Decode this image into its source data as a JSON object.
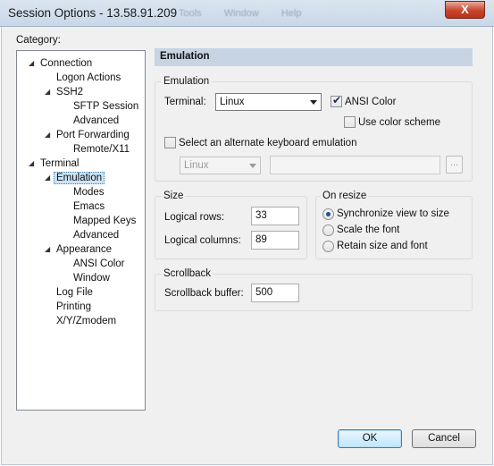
{
  "window": {
    "title": "Session Options - 13.58.91.209",
    "behind_menu": "Tools Window Help",
    "close_glyph": "X"
  },
  "category": {
    "label": "Category:",
    "tree": [
      {
        "label": "Connection",
        "expanded": true
      },
      {
        "label": "Logon Actions"
      },
      {
        "label": "SSH2",
        "expanded": true
      },
      {
        "label": "SFTP Session"
      },
      {
        "label": "Advanced"
      },
      {
        "label": "Port Forwarding",
        "expanded": true
      },
      {
        "label": "Remote/X11"
      },
      {
        "label": "Terminal",
        "expanded": true
      },
      {
        "label": "Emulation",
        "expanded": true,
        "selected": true
      },
      {
        "label": "Modes"
      },
      {
        "label": "Emacs"
      },
      {
        "label": "Mapped Keys"
      },
      {
        "label": "Advanced"
      },
      {
        "label": "Appearance",
        "expanded": true
      },
      {
        "label": "ANSI Color"
      },
      {
        "label": "Window"
      },
      {
        "label": "Log File"
      },
      {
        "label": "Printing"
      },
      {
        "label": "X/Y/Zmodem"
      }
    ]
  },
  "panel": {
    "header": "Emulation",
    "emulation": {
      "group_label": "Emulation",
      "terminal_label": "Terminal:",
      "terminal_value": "Linux",
      "ansi_color_label": "ANSI Color",
      "ansi_color_checked": true,
      "use_color_scheme_label": "Use color scheme",
      "use_color_scheme_checked": false,
      "alt_keyboard_label": "Select an alternate keyboard emulation",
      "alt_keyboard_checked": false,
      "alt_keyboard_value": "Linux",
      "alt_keyboard_path": "",
      "browse_label": "..."
    },
    "size": {
      "group_label": "Size",
      "rows_label": "Logical rows:",
      "rows_value": "33",
      "cols_label": "Logical columns:",
      "cols_value": "89"
    },
    "on_resize": {
      "group_label": "On resize",
      "options": [
        {
          "label": "Synchronize view to size",
          "selected": true
        },
        {
          "label": "Scale the font",
          "selected": false
        },
        {
          "label": "Retain size and font",
          "selected": false
        }
      ]
    },
    "scrollback": {
      "group_label": "Scrollback",
      "buffer_label": "Scrollback buffer:",
      "buffer_value": "500"
    }
  },
  "buttons": {
    "ok": "OK",
    "cancel": "Cancel"
  }
}
